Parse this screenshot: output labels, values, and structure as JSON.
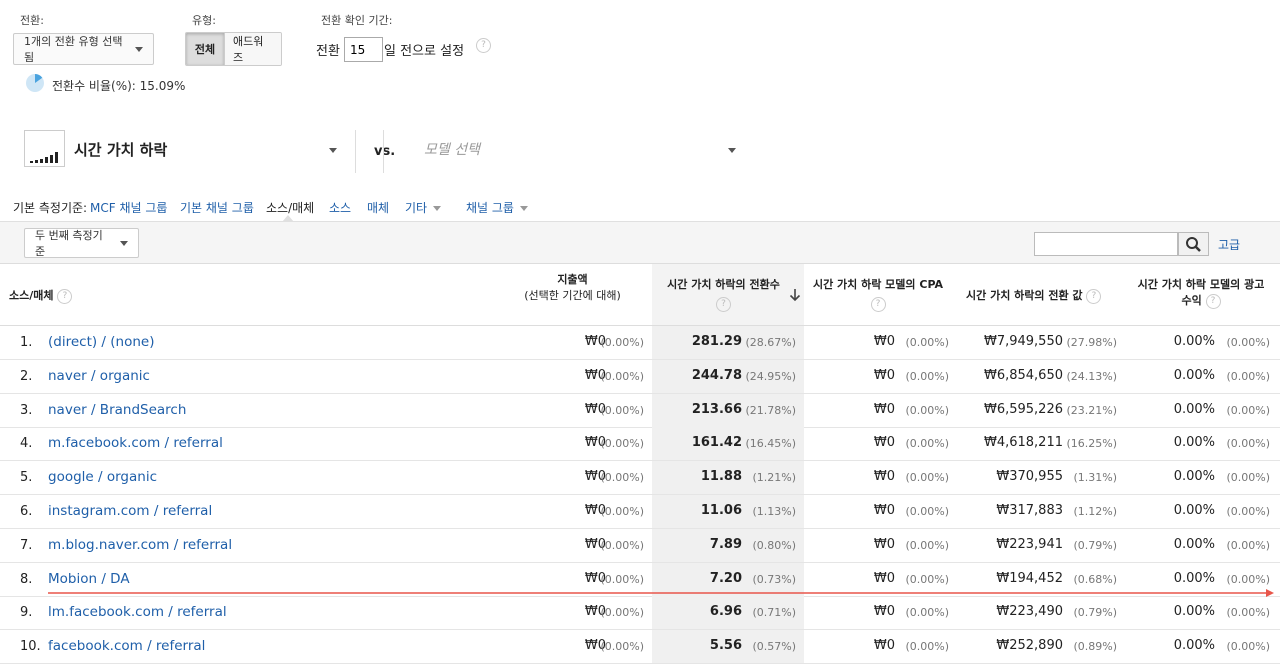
{
  "filters": {
    "conversion_label": "전환:",
    "conversion_select": "1개의 전환 유형 선택됨",
    "type_label": "유형:",
    "type_options": [
      "전체",
      "애드워즈"
    ],
    "lookback_label": "전환 확인 기간:",
    "lookback_prefix": "전환",
    "lookback_value": "15",
    "lookback_suffix": "일 전으로 설정"
  },
  "conversion_ratio": "전환수 비율(%): 15.09%",
  "conversion_ratio_pct": 15.09,
  "model": {
    "selected": "시간 가치 하락",
    "vs": "vs.",
    "placeholder": "모델 선택"
  },
  "dimension_bar": {
    "label": "기본 측정기준:",
    "tabs": [
      "MCF 채널 그룹",
      "기본 채널 그룹",
      "소스/매체",
      "소스",
      "매체",
      "기타",
      "채널 그룹"
    ],
    "active": "소스/매체"
  },
  "secondary_dimension": "두 번째 측정기준",
  "search": {
    "placeholder": "",
    "advanced": "고급"
  },
  "columns": {
    "source": "소스/매체",
    "spend_line1": "지출액",
    "spend_line2": "(선택한 기간에 대해)",
    "conversions": "시간 가치 하락의 전환수",
    "cpa": "시간 가치 하락 모델의 CPA",
    "value": "시간 가치 하락의 전환 값",
    "roas_line1": "시간 가치 하락 모델의 광고",
    "roas_line2": "수익"
  },
  "rows": [
    {
      "n": "1.",
      "src": "(direct) / (none)",
      "spend": "₩0",
      "spend_p": "(0.00%)",
      "conv": "281.29",
      "conv_p": "(28.67%)",
      "cpa": "₩0",
      "cpa_p": "(0.00%)",
      "val": "₩7,949,550",
      "val_p": "(27.98%)",
      "roas": "0.00%",
      "roas_p": "(0.00%)"
    },
    {
      "n": "2.",
      "src": "naver / organic",
      "spend": "₩0",
      "spend_p": "(0.00%)",
      "conv": "244.78",
      "conv_p": "(24.95%)",
      "cpa": "₩0",
      "cpa_p": "(0.00%)",
      "val": "₩6,854,650",
      "val_p": "(24.13%)",
      "roas": "0.00%",
      "roas_p": "(0.00%)"
    },
    {
      "n": "3.",
      "src": "naver / BrandSearch",
      "spend": "₩0",
      "spend_p": "(0.00%)",
      "conv": "213.66",
      "conv_p": "(21.78%)",
      "cpa": "₩0",
      "cpa_p": "(0.00%)",
      "val": "₩6,595,226",
      "val_p": "(23.21%)",
      "roas": "0.00%",
      "roas_p": "(0.00%)"
    },
    {
      "n": "4.",
      "src": "m.facebook.com / referral",
      "spend": "₩0",
      "spend_p": "(0.00%)",
      "conv": "161.42",
      "conv_p": "(16.45%)",
      "cpa": "₩0",
      "cpa_p": "(0.00%)",
      "val": "₩4,618,211",
      "val_p": "(16.25%)",
      "roas": "0.00%",
      "roas_p": "(0.00%)"
    },
    {
      "n": "5.",
      "src": "google / organic",
      "spend": "₩0",
      "spend_p": "(0.00%)",
      "conv": "11.88",
      "conv_p": "(1.21%)",
      "cpa": "₩0",
      "cpa_p": "(0.00%)",
      "val": "₩370,955",
      "val_p": "(1.31%)",
      "roas": "0.00%",
      "roas_p": "(0.00%)"
    },
    {
      "n": "6.",
      "src": "instagram.com / referral",
      "spend": "₩0",
      "spend_p": "(0.00%)",
      "conv": "11.06",
      "conv_p": "(1.13%)",
      "cpa": "₩0",
      "cpa_p": "(0.00%)",
      "val": "₩317,883",
      "val_p": "(1.12%)",
      "roas": "0.00%",
      "roas_p": "(0.00%)"
    },
    {
      "n": "7.",
      "src": "m.blog.naver.com / referral",
      "spend": "₩0",
      "spend_p": "(0.00%)",
      "conv": "7.89",
      "conv_p": "(0.80%)",
      "cpa": "₩0",
      "cpa_p": "(0.00%)",
      "val": "₩223,941",
      "val_p": "(0.79%)",
      "roas": "0.00%",
      "roas_p": "(0.00%)"
    },
    {
      "n": "8.",
      "src": "Mobion / DA",
      "spend": "₩0",
      "spend_p": "(0.00%)",
      "conv": "7.20",
      "conv_p": "(0.73%)",
      "cpa": "₩0",
      "cpa_p": "(0.00%)",
      "val": "₩194,452",
      "val_p": "(0.68%)",
      "roas": "0.00%",
      "roas_p": "(0.00%)"
    },
    {
      "n": "9.",
      "src": "lm.facebook.com / referral",
      "spend": "₩0",
      "spend_p": "(0.00%)",
      "conv": "6.96",
      "conv_p": "(0.71%)",
      "cpa": "₩0",
      "cpa_p": "(0.00%)",
      "val": "₩223,490",
      "val_p": "(0.79%)",
      "roas": "0.00%",
      "roas_p": "(0.00%)"
    },
    {
      "n": "10.",
      "src": "facebook.com / referral",
      "spend": "₩0",
      "spend_p": "(0.00%)",
      "conv": "5.56",
      "conv_p": "(0.57%)",
      "cpa": "₩0",
      "cpa_p": "(0.00%)",
      "val": "₩252,890",
      "val_p": "(0.89%)",
      "roas": "0.00%",
      "roas_p": "(0.00%)"
    }
  ],
  "colors": {
    "link": "#1f5fa9",
    "annotation_arrow": "#e8554a",
    "pie": "#4aa3df"
  }
}
